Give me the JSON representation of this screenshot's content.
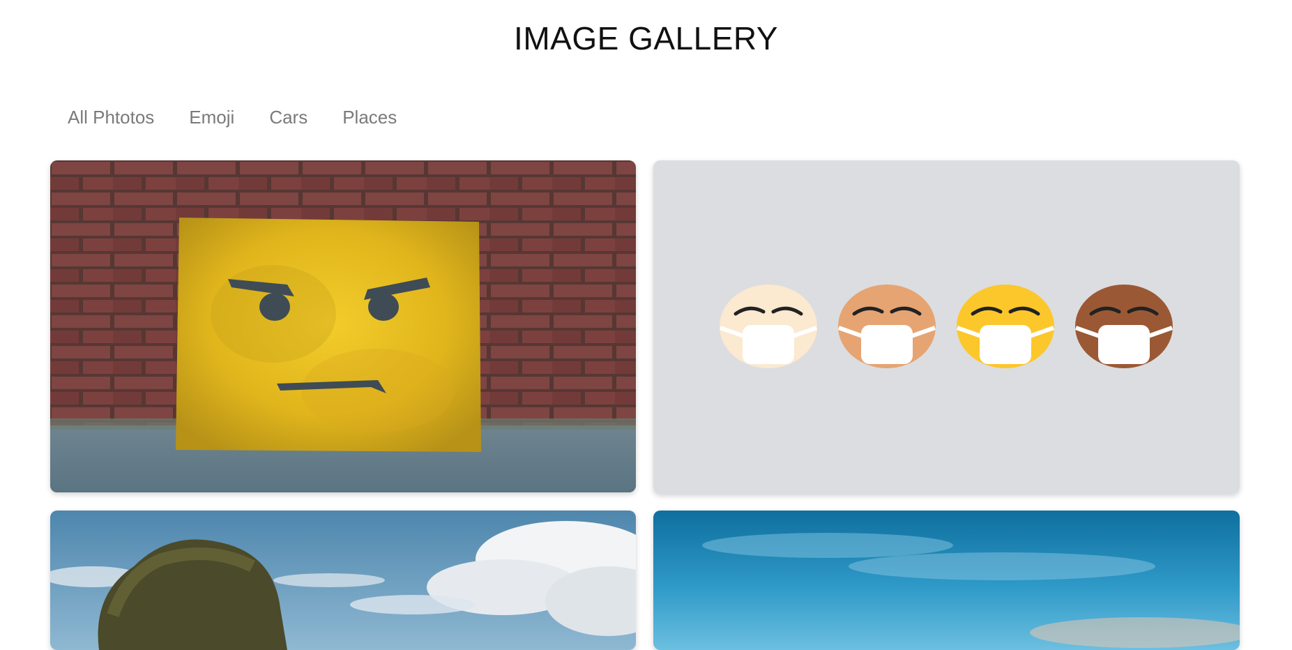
{
  "header": {
    "title": "IMAGE GALLERY"
  },
  "filters": [
    {
      "label": "All Phtotos"
    },
    {
      "label": "Emoji"
    },
    {
      "label": "Cars"
    },
    {
      "label": "Places"
    }
  ],
  "gallery": {
    "items": [
      {
        "subject": "angry-face-sign-on-brick-wall",
        "category": "Emoji"
      },
      {
        "subject": "four-masked-face-emojis",
        "category": "Emoji"
      },
      {
        "subject": "rock-island-under-cloudy-sky",
        "category": "Places"
      },
      {
        "subject": "blue-sky-over-sea",
        "category": "Places"
      }
    ]
  },
  "colors": {
    "title": "#111111",
    "filter_text": "#7a7a7a",
    "card_gray_bg": "#dcdde0",
    "emoji_skin": [
      "#fbe9d0",
      "#e6a472",
      "#fcc72a",
      "#9a5934"
    ]
  }
}
